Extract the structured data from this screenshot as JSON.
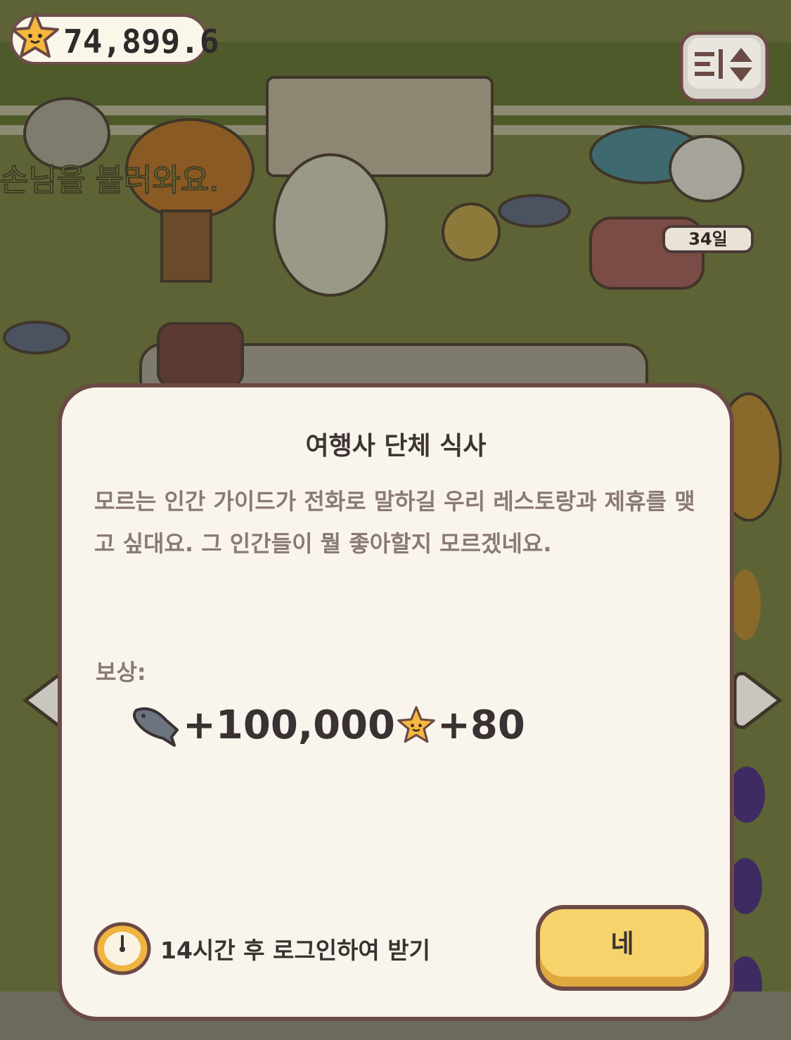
{
  "hud": {
    "currency_value": "74,899.6",
    "currency_icon": "star-icon"
  },
  "scene": {
    "banner_text": "손님을 불러와요.",
    "day_badge": "34일"
  },
  "dialog": {
    "title": "여행사 단체 식사",
    "body": "모르는 인간 가이드가 전화로 말하길 우리 레스토랑과 제휴를 맺고 싶대요. 그 인간들이 뭘 좋아할지 모르겠네요.",
    "reward_label": "보상:",
    "reward_fish": "+100,000",
    "reward_star": "+80",
    "timer_text": "14시간 후 로그인하여 받기",
    "confirm_label": "네"
  },
  "colors": {
    "panel_bg": "#faf5ec",
    "panel_border": "#6b4a45",
    "button_yellow": "#f7d36b",
    "grass": "#5e6436"
  }
}
